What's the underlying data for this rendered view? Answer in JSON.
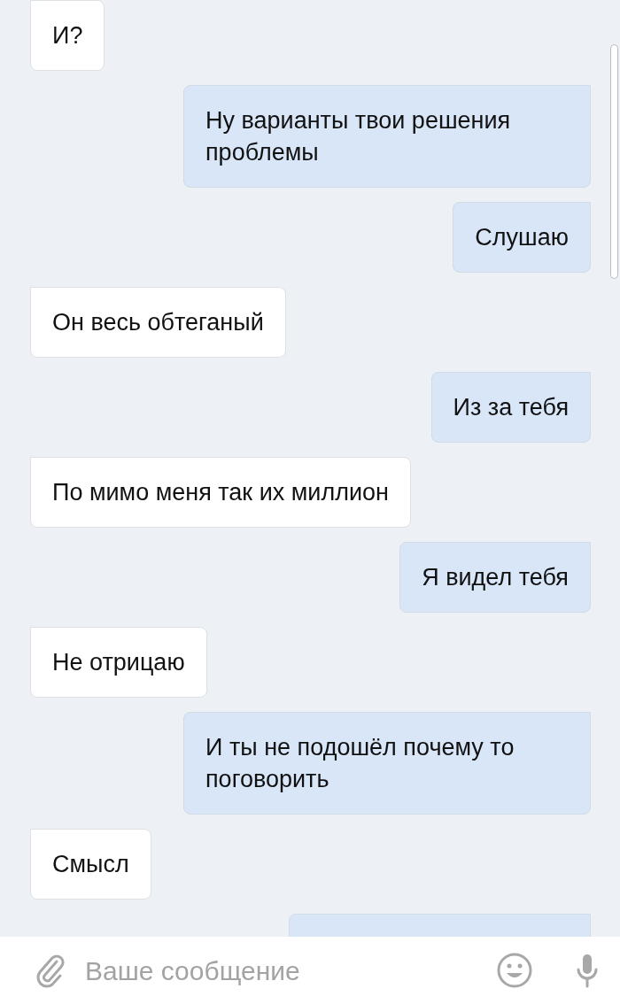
{
  "messages": [
    {
      "outgoing": false,
      "kind": "text",
      "text": "И?"
    },
    {
      "outgoing": true,
      "kind": "text",
      "text": "Ну варианты твои решения проблемы"
    },
    {
      "outgoing": true,
      "kind": "text",
      "text": "Слушаю"
    },
    {
      "outgoing": false,
      "kind": "text",
      "text": "Он весь обтеганый"
    },
    {
      "outgoing": true,
      "kind": "text",
      "text": "Из за тебя"
    },
    {
      "outgoing": false,
      "kind": "text",
      "text": "По мимо меня так их миллион"
    },
    {
      "outgoing": true,
      "kind": "text",
      "text": "Я видел тебя"
    },
    {
      "outgoing": false,
      "kind": "text",
      "text": "Не отрицаю"
    },
    {
      "outgoing": true,
      "kind": "text",
      "text": "И ты не подошёл почему то поговорить"
    },
    {
      "outgoing": false,
      "kind": "text",
      "text": "Смысл"
    },
    {
      "outgoing": true,
      "kind": "cut"
    }
  ],
  "composer": {
    "placeholder": "Ваше сообщение"
  }
}
